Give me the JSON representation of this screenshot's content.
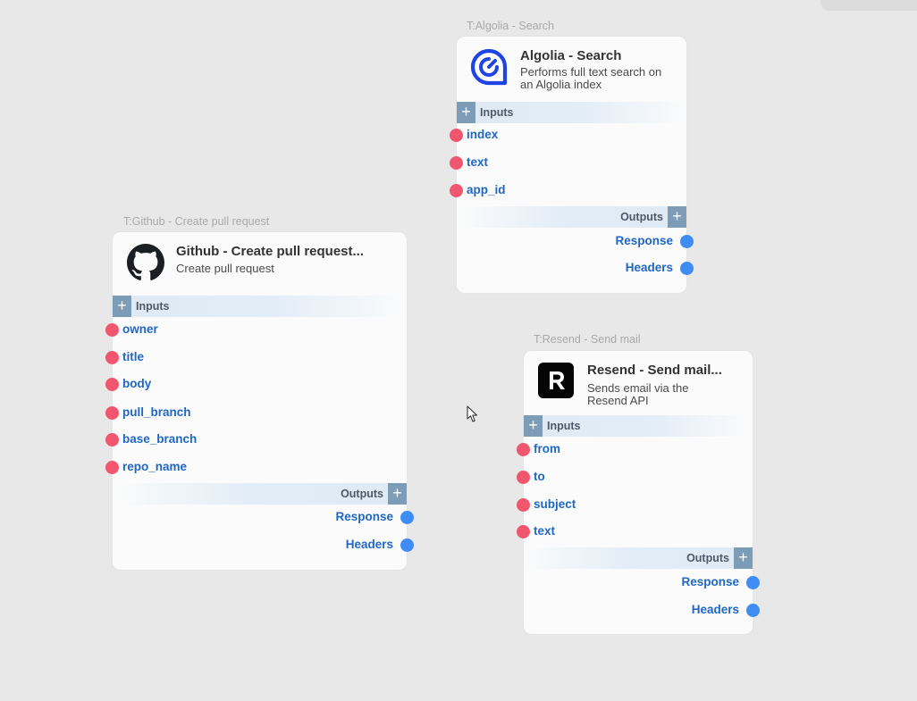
{
  "nodes": {
    "algolia": {
      "tag": "T:Algolia - Search",
      "title": "Algolia - Search",
      "description": "Performs full text search on an Algolia index",
      "logo": "algolia-logo",
      "inputs_label": "Inputs",
      "outputs_label": "Outputs",
      "inputs": [
        "index",
        "text",
        "app_id"
      ],
      "outputs": [
        "Response",
        "Headers"
      ]
    },
    "github": {
      "tag": "T:Github - Create pull request",
      "title": "Github - Create pull request...",
      "description": "Create pull request",
      "logo": "github-logo",
      "inputs_label": "Inputs",
      "outputs_label": "Outputs",
      "inputs": [
        "owner",
        "title",
        "body",
        "pull_branch",
        "base_branch",
        "repo_name"
      ],
      "outputs": [
        "Response",
        "Headers"
      ]
    },
    "resend": {
      "tag": "T:Resend - Send mail",
      "title": "Resend - Send mail...",
      "description": "Sends email via the Resend API",
      "logo": "resend-logo",
      "inputs_label": "Inputs",
      "outputs_label": "Outputs",
      "inputs": [
        "from",
        "to",
        "subject",
        "text"
      ],
      "outputs": [
        "Response",
        "Headers"
      ]
    }
  },
  "colors": {
    "canvas": "#e8e8e8",
    "input_port": "#f0566e",
    "output_port": "#3f8cf5",
    "port_label": "#1f67c4",
    "section_button": "#7d9cb8"
  }
}
